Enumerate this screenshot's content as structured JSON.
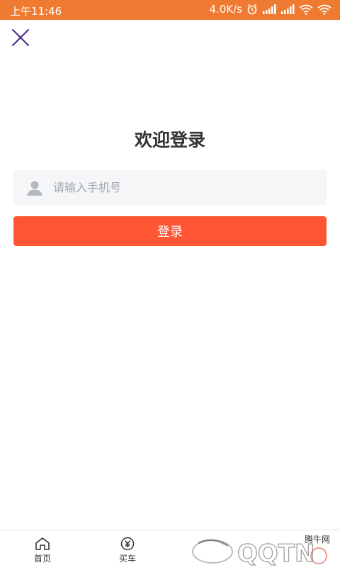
{
  "status_bar": {
    "time": "上午11:46",
    "network_speed": "4.0K/s",
    "background": "#ef7a32"
  },
  "close_icon": "close-icon",
  "title": "欢迎登录",
  "phone_input": {
    "placeholder": "请输入手机号",
    "value": ""
  },
  "login_button": {
    "label": "登录",
    "color": "#fe5634"
  },
  "tabs": [
    {
      "label": "首页",
      "icon": "home-icon"
    },
    {
      "label": "买车",
      "icon": "yen-icon"
    },
    {
      "label": "",
      "icon": ""
    },
    {
      "label": "",
      "icon": ""
    }
  ],
  "watermark": {
    "text": "腾牛网"
  }
}
